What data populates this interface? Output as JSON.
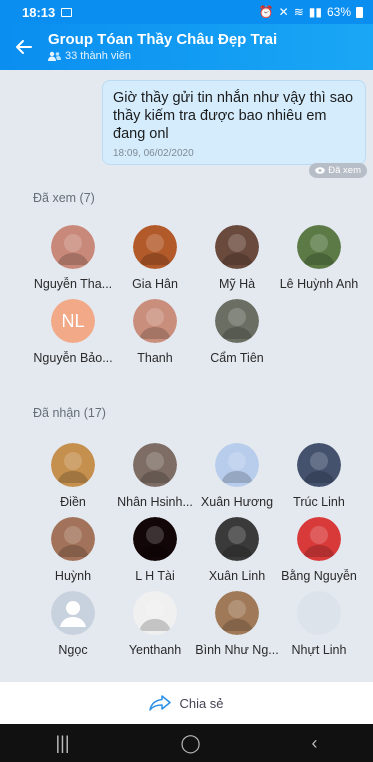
{
  "status": {
    "time": "18:13",
    "battery": "63%"
  },
  "header": {
    "title": "Group Tóan Thầy Châu Đẹp Trai",
    "subtitle": "33 thành viên"
  },
  "message": {
    "text": "Giờ thầy gửi tin nhắn như vậy thì sao thầy kiếm tra được bao nhiêu em đang onl",
    "timestamp": "18:09, 06/02/2020",
    "seen_label": "Đã xem"
  },
  "seen_section": {
    "title": "Đã xem (7)",
    "members": [
      {
        "name": "Nguyễn Tha...",
        "avatar": "photo-woman",
        "color": "#c9897a"
      },
      {
        "name": "Gia Hân",
        "avatar": "photo-mascot",
        "color": "#b35a2a"
      },
      {
        "name": "Mỹ Hà",
        "avatar": "photo-woman",
        "color": "#6b4a3e"
      },
      {
        "name": "Lê Huỳnh Anh",
        "avatar": "photo-outdoor",
        "color": "#5b7a46"
      },
      {
        "name": "Nguyễn Bảo...",
        "avatar": "initials",
        "initials": "NL",
        "color": "#f1a987"
      },
      {
        "name": "Thanh",
        "avatar": "photo-woman",
        "color": "#c98e7c"
      },
      {
        "name": "Cẩm Tiên",
        "avatar": "photo-group",
        "color": "#6b6e62"
      }
    ]
  },
  "received_section": {
    "title": "Đã nhận (17)",
    "members": [
      {
        "name": "Điền",
        "avatar": "photo-dog",
        "color": "#c58f4d"
      },
      {
        "name": "Nhân Hsinh...",
        "avatar": "photo-people",
        "color": "#7d6d64"
      },
      {
        "name": "Xuân Hương",
        "avatar": "photo-light",
        "color": "#b8ccec"
      },
      {
        "name": "Trúc Linh",
        "avatar": "photo-city",
        "color": "#44526e"
      },
      {
        "name": "Huỳnh",
        "avatar": "photo-cat",
        "color": "#a2735a"
      },
      {
        "name": "L H Tài",
        "avatar": "photo-dark",
        "color": "#120608"
      },
      {
        "name": "Xuân Linh",
        "avatar": "photo-pattern",
        "color": "#3a3a3a"
      },
      {
        "name": "Bằng Nguyễn",
        "avatar": "photo-man",
        "color": "#d83a3a"
      },
      {
        "name": "Ngọc",
        "avatar": "default-user",
        "color": "#c8d2de"
      },
      {
        "name": "Yenthanh",
        "avatar": "photo-deer",
        "color": "#f0f0f0"
      },
      {
        "name": "Bình Như Ng...",
        "avatar": "photo-art",
        "color": "#a07a58"
      },
      {
        "name": "Nhựt Linh",
        "avatar": "empty",
        "color": "#dde3ea"
      }
    ]
  },
  "share": {
    "label": "Chia sẻ"
  },
  "nav": {
    "recents": "|||",
    "home": "◯",
    "back": "‹"
  }
}
